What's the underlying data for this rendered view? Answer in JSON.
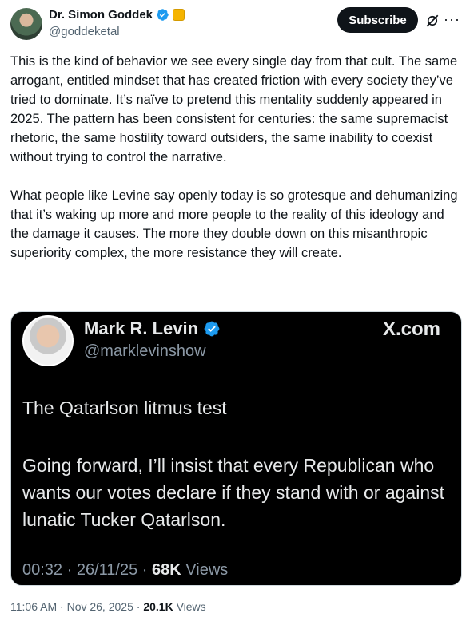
{
  "author": {
    "display_name": "Dr. Simon Goddek",
    "handle": "@goddeketal",
    "verified_icon": "verified-badge-icon",
    "affiliation_icon": "affiliation-badge-icon",
    "accent_color": "#1d9bf0"
  },
  "header": {
    "subscribe_label": "Subscribe",
    "grok_icon": "grok-icon",
    "more_icon": "more-icon",
    "more_glyph": "···"
  },
  "post": {
    "paragraphs": [
      "This is the kind of behavior we see every single day from that cult. The same arrogant, entitled mindset that has created friction with every society they’ve tried to dominate. It’s naïve to pretend this mentality suddenly appeared in 2025. The pattern has been consistent for centuries: the same supremacist rhetoric, the same hostility toward outsiders, the same inability to coexist without trying to control the narrative.",
      "What people like Levine say openly today is so grotesque and dehumanizing that it’s waking up more and more people to the reality of this ideology and the damage it causes. The more they double down on this misanthropic superiority complex, the more resistance they will create."
    ]
  },
  "media": {
    "display_name": "Mark R. Levin",
    "handle": "@marklevinshow",
    "source": "X.com",
    "line1": "The Qatarlson litmus test",
    "line2": "Going forward, I’ll insist that every Republican who wants our votes declare if they stand with or against lunatic Tucker Qatarlson.",
    "time": "00:32",
    "date": "26/11/25",
    "views_count": "68K",
    "views_label": "Views",
    "background": "#000000"
  },
  "footer": {
    "time": "11:06 AM",
    "date": "Nov 26, 2025",
    "views_count": "20.1K",
    "views_label": "Views",
    "separator": "·"
  }
}
